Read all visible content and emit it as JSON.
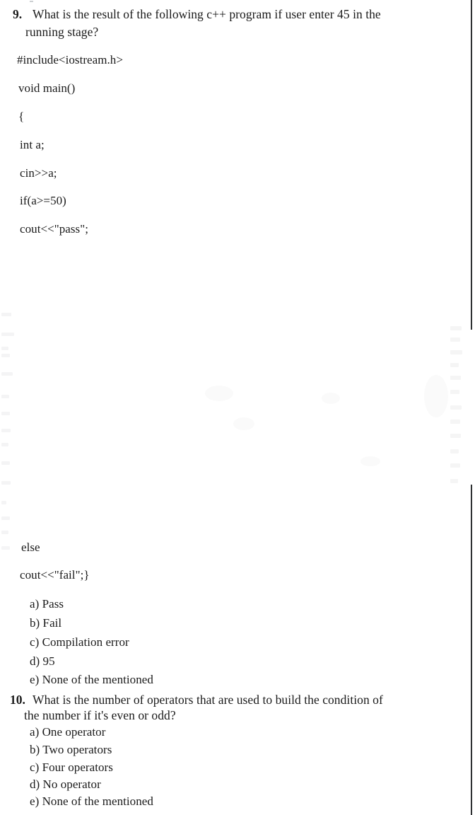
{
  "document": {
    "kind": "scanned-exam-page",
    "background_color": "#ffffff",
    "text_color": "#1a1a1a",
    "margin_rule_color": "#2e3133"
  },
  "questions": [
    {
      "number": "9.",
      "prompt_line_1": "What is the result of the following c++ program if user enter 45 in the",
      "prompt_line_2": "running stage?",
      "code": [
        "#include<iostream.h>",
        "void main()",
        "{",
        "int a;",
        "cin>>a;",
        "if(a>=50)",
        "cout<<\"pass\";",
        "else",
        "cout<<\"fail\";}"
      ],
      "options": [
        "a) Pass",
        "b) Fail",
        "c) Compilation error",
        "d) 95",
        "e) None of the mentioned"
      ]
    },
    {
      "number": "10.",
      "prompt_line_1": "What is the number of operators that are used to build the condition of",
      "prompt_line_2": "the number if it's even or odd?",
      "options": [
        "a) One operator",
        "b) Two operators",
        "c) Four operators",
        "d) No operator",
        "e) None of the mentioned"
      ]
    }
  ]
}
